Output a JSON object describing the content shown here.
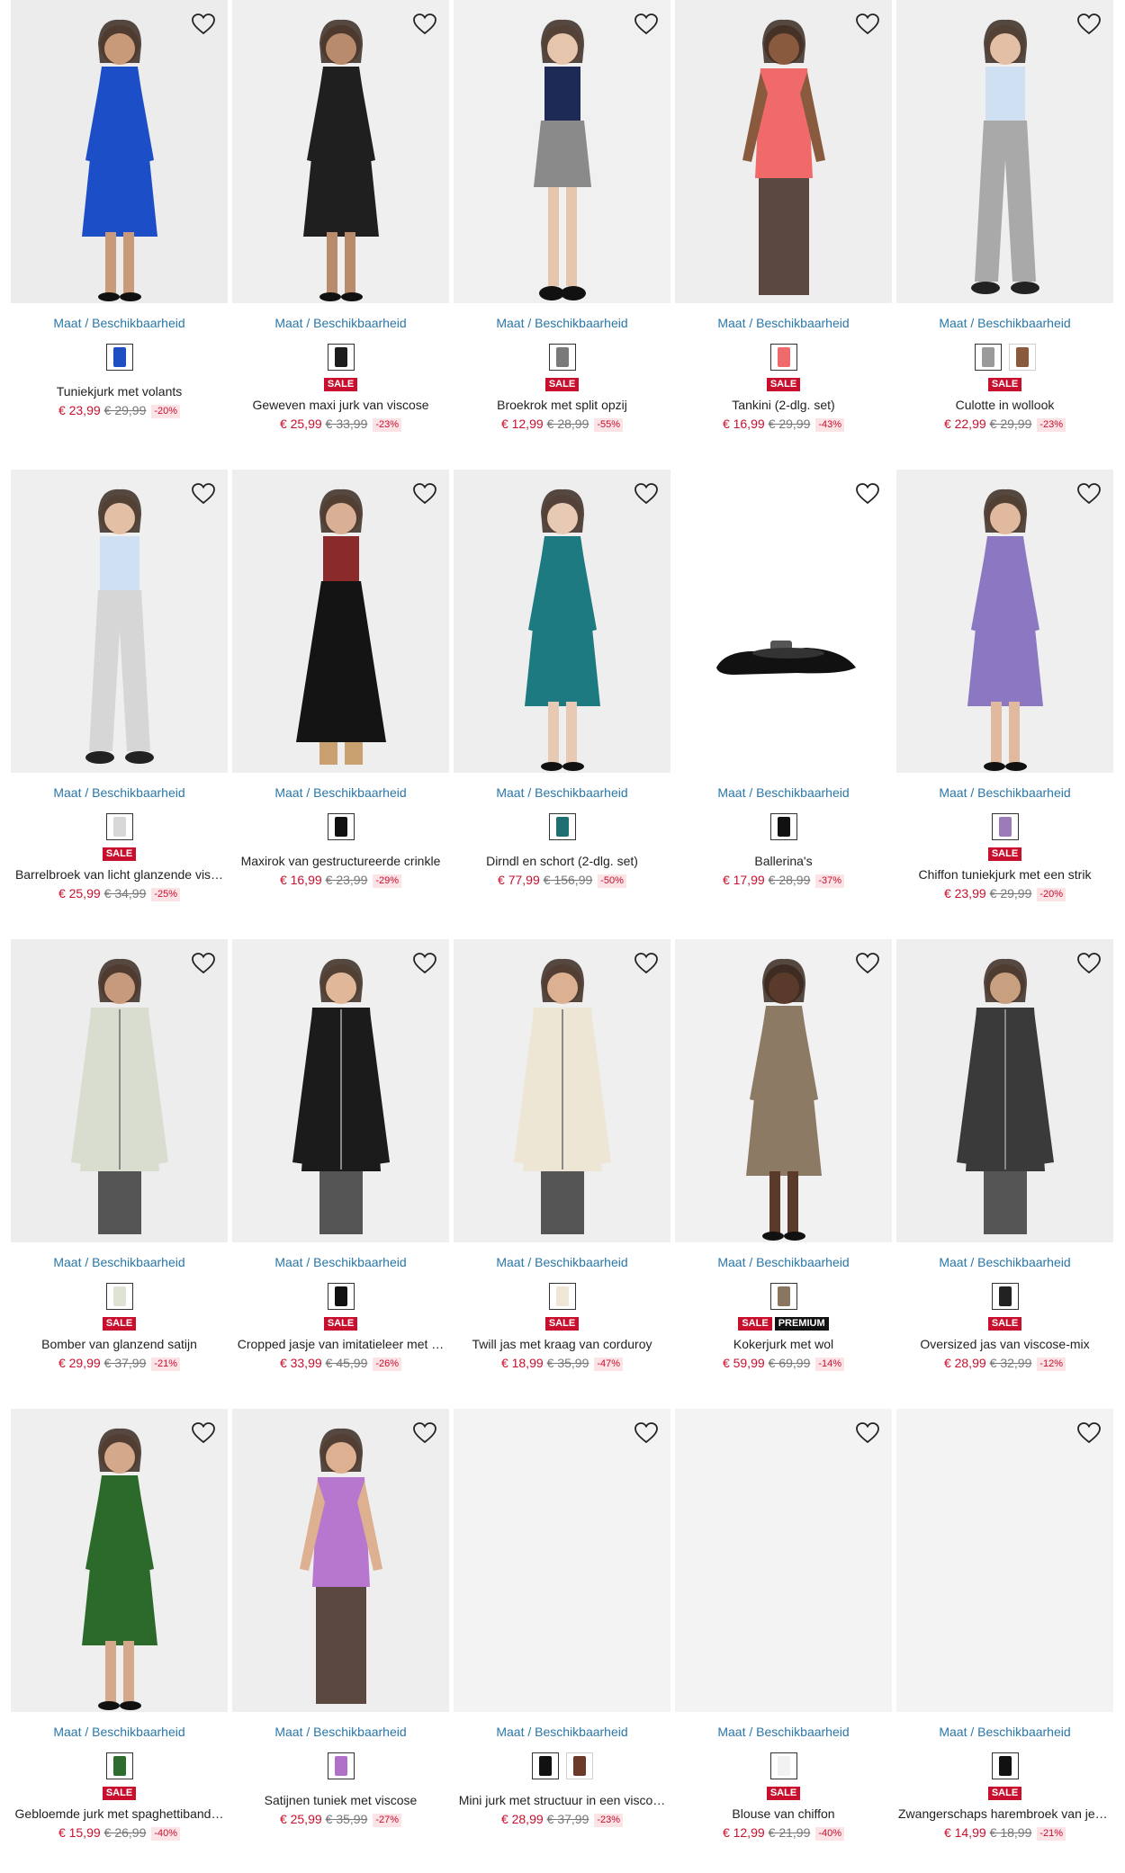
{
  "size_link_label": "Maat / Beschikbaarheid",
  "products": [
    {
      "name": "Tuniekjurk met volants",
      "price": "€ 23,99",
      "old_price": "€ 29,99",
      "discount": "-20%",
      "badges": [],
      "swatches": [
        {
          "color": "#1e4fc2",
          "icon": "dress-icon"
        }
      ],
      "image": {
        "bg": "#ececec",
        "fig": "#1c4fc7",
        "skin": "#c99a7a",
        "shape": "dress"
      }
    },
    {
      "name": "Geweven maxi jurk van viscose",
      "price": "€ 25,99",
      "old_price": "€ 33,99",
      "discount": "-23%",
      "badges": [
        "SALE"
      ],
      "swatches": [
        {
          "color": "#1c1c1c",
          "icon": "dress-icon"
        }
      ],
      "image": {
        "bg": "#efefef",
        "fig": "#1f1f1f",
        "skin": "#b88b6c",
        "shape": "dress"
      }
    },
    {
      "name": "Broekrok met split opzij",
      "price": "€ 12,99",
      "old_price": "€ 28,99",
      "discount": "-55%",
      "badges": [
        "SALE"
      ],
      "swatches": [
        {
          "color": "#7a7a7a",
          "icon": "skirt-icon"
        }
      ],
      "image": {
        "bg": "#f0f0f0",
        "fig": "#8a8a8a",
        "skin": "#e6c5ad",
        "shape": "skirt"
      }
    },
    {
      "name": "Tankini (2-dlg. set)",
      "price": "€ 16,99",
      "old_price": "€ 29,99",
      "discount": "-43%",
      "badges": [
        "SALE"
      ],
      "swatches": [
        {
          "color": "#ef6b6b",
          "icon": "swimwear-icon"
        }
      ],
      "image": {
        "bg": "#eeeeee",
        "fig": "#f06a6a",
        "skin": "#8a5a3f",
        "shape": "top"
      }
    },
    {
      "name": "Culotte in wollook",
      "price": "€ 22,99",
      "old_price": "€ 29,99",
      "discount": "-23%",
      "badges": [
        "SALE"
      ],
      "swatches": [
        {
          "color": "#9a9a9a",
          "icon": "trousers-icon"
        },
        {
          "color": "#8b5a3c",
          "icon": "trousers-icon"
        }
      ],
      "image": {
        "bg": "#efefef",
        "fig": "#a9a9a9",
        "skin": "#e2bfa5",
        "shape": "pants"
      }
    },
    {
      "name": "Barrelbroek van licht glanzende vis…",
      "price": "€ 25,99",
      "old_price": "€ 34,99",
      "discount": "-25%",
      "badges": [
        "SALE"
      ],
      "swatches": [
        {
          "color": "#d8d8d8",
          "icon": "trousers-icon"
        }
      ],
      "image": {
        "bg": "#efefef",
        "fig": "#d6d6d6",
        "skin": "#e2bfa5",
        "shape": "pants"
      }
    },
    {
      "name": "Maxirok van gestructureerde crinkle",
      "price": "€ 16,99",
      "old_price": "€ 23,99",
      "discount": "-29%",
      "badges": [],
      "swatches": [
        {
          "color": "#111111",
          "icon": "skirt-icon"
        }
      ],
      "image": {
        "bg": "#eeeeee",
        "fig": "#141414",
        "skin": "#d9b096",
        "shape": "longskirt"
      }
    },
    {
      "name": "Dirndl en schort (2-dlg. set)",
      "price": "€ 77,99",
      "old_price": "€ 156,99",
      "discount": "-50%",
      "badges": [],
      "swatches": [
        {
          "color": "#1f6f72",
          "icon": "dress-icon"
        }
      ],
      "image": {
        "bg": "#eeeeee",
        "fig": "#1d7a80",
        "skin": "#e8c9b3",
        "shape": "dress"
      }
    },
    {
      "name": "Ballerina's",
      "price": "€ 17,99",
      "old_price": "€ 28,99",
      "discount": "-37%",
      "badges": [],
      "swatches": [
        {
          "color": "#111111",
          "icon": "shoe-icon"
        }
      ],
      "image": {
        "bg": "#ffffff",
        "fig": "#111111",
        "skin": "#ffffff",
        "shape": "shoe"
      }
    },
    {
      "name": "Chiffon tuniekjurk met een strik",
      "price": "€ 23,99",
      "old_price": "€ 29,99",
      "discount": "-20%",
      "badges": [
        "SALE"
      ],
      "swatches": [
        {
          "color": "#9b7bb8",
          "icon": "dress-icon"
        }
      ],
      "image": {
        "bg": "#efefef",
        "fig": "#8c78c2",
        "skin": "#e1b99e",
        "shape": "dress"
      }
    },
    {
      "name": "Bomber van glanzend satijn",
      "price": "€ 29,99",
      "old_price": "€ 37,99",
      "discount": "-21%",
      "badges": [
        "SALE"
      ],
      "swatches": [
        {
          "color": "#dfe3d6",
          "icon": "jacket-icon"
        }
      ],
      "image": {
        "bg": "#ededed",
        "fig": "#d8ddd0",
        "skin": "#c79a7e",
        "shape": "jacket"
      }
    },
    {
      "name": "Cropped jasje van imitatieleer met …",
      "price": "€ 33,99",
      "old_price": "€ 45,99",
      "discount": "-26%",
      "badges": [
        "SALE"
      ],
      "swatches": [
        {
          "color": "#111111",
          "icon": "jacket-icon"
        }
      ],
      "image": {
        "bg": "#efefef",
        "fig": "#1b1b1b",
        "skin": "#e0b899",
        "shape": "jacket"
      }
    },
    {
      "name": "Twill jas met kraag van corduroy",
      "price": "€ 18,99",
      "old_price": "€ 35,99",
      "discount": "-47%",
      "badges": [
        "SALE"
      ],
      "swatches": [
        {
          "color": "#efe6d6",
          "icon": "jacket-icon"
        }
      ],
      "image": {
        "bg": "#efefef",
        "fig": "#eee6d4",
        "skin": "#dcb191",
        "shape": "jacket"
      }
    },
    {
      "name": "Kokerjurk met wol",
      "price": "€ 59,99",
      "old_price": "€ 69,99",
      "discount": "-14%",
      "badges": [
        "SALE",
        "PREMIUM"
      ],
      "swatches": [
        {
          "color": "#8a7561",
          "icon": "dress-icon"
        }
      ],
      "image": {
        "bg": "#f1f1f1",
        "fig": "#8d7a64",
        "skin": "#5a3a2a",
        "shape": "dress"
      }
    },
    {
      "name": "Oversized jas van viscose-mix",
      "price": "€ 28,99",
      "old_price": "€ 32,99",
      "discount": "-12%",
      "badges": [
        "SALE"
      ],
      "swatches": [
        {
          "color": "#222222",
          "icon": "jacket-icon"
        }
      ],
      "image": {
        "bg": "#eeeeee",
        "fig": "#3a3a3a",
        "skin": "#c9a07f",
        "shape": "jacket"
      }
    },
    {
      "name": "Gebloemde jurk met spaghettiband…",
      "price": "€ 15,99",
      "old_price": "€ 26,99",
      "discount": "-40%",
      "badges": [
        "SALE"
      ],
      "swatches": [
        {
          "color": "#2e6b2e",
          "icon": "dress-icon"
        }
      ],
      "image": {
        "bg": "#efefef",
        "fig": "#2b6a2b",
        "skin": "#d4a88a",
        "shape": "dress"
      }
    },
    {
      "name": "Satijnen tuniek met viscose",
      "price": "€ 25,99",
      "old_price": "€ 35,99",
      "discount": "-27%",
      "badges": [],
      "swatches": [
        {
          "color": "#b070c8",
          "icon": "blouse-icon"
        }
      ],
      "image": {
        "bg": "#eeeeee",
        "fig": "#b877cf",
        "skin": "#dcb091",
        "shape": "top"
      }
    },
    {
      "name": "Mini jurk met structuur in een visco…",
      "price": "€ 28,99",
      "old_price": "€ 37,99",
      "discount": "-23%",
      "badges": [],
      "swatches": [
        {
          "color": "#111111",
          "icon": "dress-icon"
        },
        {
          "color": "#6b3a2a",
          "icon": "dress-icon"
        }
      ],
      "image": {
        "bg": "#f3f3f3",
        "fig": "",
        "skin": "",
        "shape": "none"
      }
    },
    {
      "name": "Blouse van chiffon",
      "price": "€ 12,99",
      "old_price": "€ 21,99",
      "discount": "-40%",
      "badges": [
        "SALE"
      ],
      "swatches": [
        {
          "color": "#f2f2f2",
          "icon": "blouse-icon"
        }
      ],
      "image": {
        "bg": "#f3f3f3",
        "fig": "",
        "skin": "",
        "shape": "none"
      }
    },
    {
      "name": "Zwangerschaps harembroek van jer…",
      "price": "€ 14,99",
      "old_price": "€ 18,99",
      "discount": "-21%",
      "badges": [
        "SALE"
      ],
      "swatches": [
        {
          "color": "#111111",
          "icon": "trousers-icon"
        }
      ],
      "image": {
        "bg": "#f3f3f3",
        "fig": "",
        "skin": "",
        "shape": "none"
      }
    }
  ]
}
